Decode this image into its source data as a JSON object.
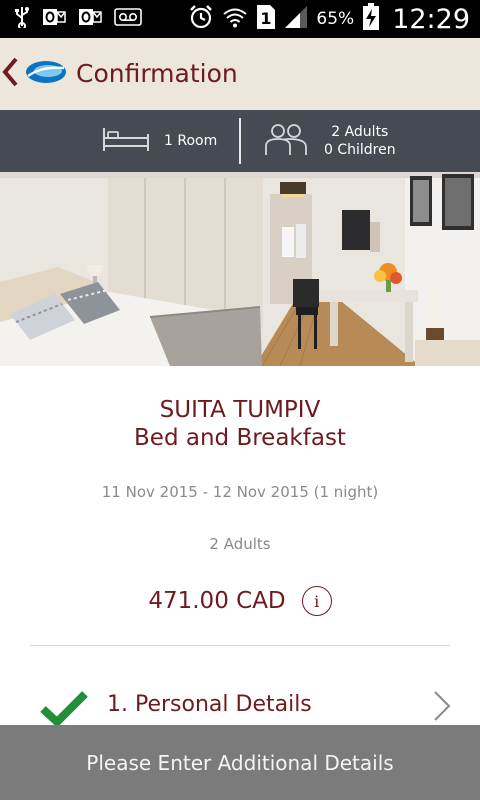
{
  "status_bar": {
    "icons_left": [
      "usb-icon",
      "outlook-icon",
      "outlook-icon",
      "voicemail-icon"
    ],
    "icons_right": [
      "alarm-icon",
      "wifi-icon",
      "sim-icon",
      "signal-icon",
      "battery-charging-icon"
    ],
    "sim_slot": "1",
    "battery_percent": "65%",
    "time": "12:29"
  },
  "app_bar": {
    "title": "Confirmation",
    "back_icon": "chevron-left-icon",
    "logo_icon": "brand-logo-icon"
  },
  "booking_summary": {
    "rooms": "1 Room",
    "adults": "2 Adults",
    "children": "0 Children",
    "room_icon": "bed-icon",
    "guests_icon": "people-icon"
  },
  "hotel": {
    "name_line1": "SUITA TUMPIV",
    "name_line2": "Bed and Breakfast",
    "dates": "11 Nov 2015 - 12 Nov 2015 (1 night)",
    "guests": "2 Adults",
    "price": "471.00 CAD",
    "info_glyph": "i"
  },
  "steps": [
    {
      "label": "1. Personal Details",
      "status": "complete"
    }
  ],
  "cta": {
    "label": "Please Enter Additional Details"
  },
  "colors": {
    "accent": "#6e1a1f",
    "app_bar_bg": "#ede6da",
    "summary_bar_bg": "#454a53",
    "cta_bg": "#7b7b7b",
    "check_green": "#1f8f3a"
  }
}
